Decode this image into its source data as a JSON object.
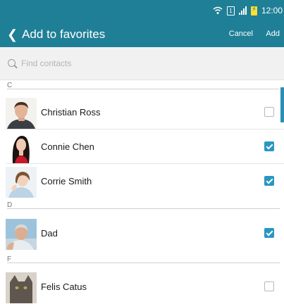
{
  "status_bar": {
    "time": "12:00"
  },
  "app_bar": {
    "title": "Add to favorites",
    "cancel_label": "Cancel",
    "add_label": "Add"
  },
  "search": {
    "placeholder": "Find contacts"
  },
  "sections": [
    {
      "letter": "C",
      "contacts": [
        {
          "name": "Christian Ross",
          "checked": false
        },
        {
          "name": "Connie Chen",
          "checked": true
        },
        {
          "name": "Corrie Smith",
          "checked": true
        }
      ]
    },
    {
      "letter": "D",
      "contacts": [
        {
          "name": "Dad",
          "checked": true
        }
      ]
    },
    {
      "letter": "F",
      "contacts": [
        {
          "name": "Felis Catus",
          "checked": false
        }
      ]
    }
  ],
  "colors": {
    "header": "#1f7f96",
    "accent": "#2a96c2"
  }
}
